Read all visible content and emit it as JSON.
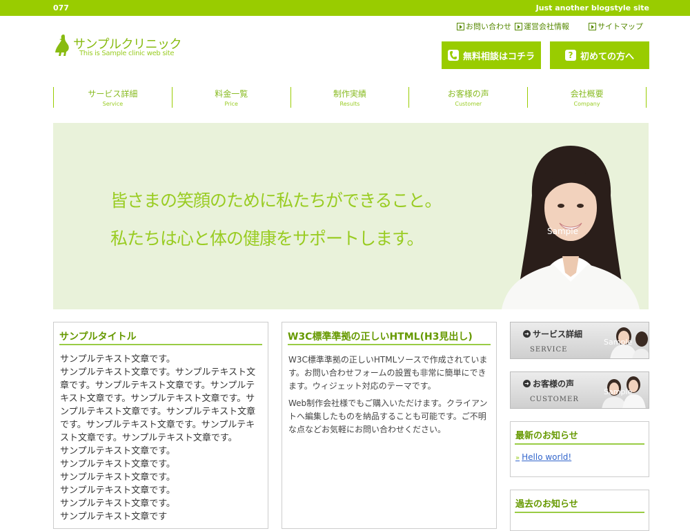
{
  "topbar": {
    "number": "077",
    "tagline": "Just another blogstyle site"
  },
  "logo": {
    "name": "サンプルクリニック",
    "subtitle": "This is Sample clinic web site"
  },
  "util_links": [
    {
      "label": "お問い合わせ"
    },
    {
      "label": "運営会社情報"
    },
    {
      "label": "サイトマップ"
    }
  ],
  "header_buttons": [
    {
      "label": "無料相談はコチラ",
      "icon": "phone-icon"
    },
    {
      "label": "初めての方へ",
      "icon": "question-icon",
      "glyph": "?"
    }
  ],
  "nav": [
    {
      "jp": "サービス詳細",
      "en": "Service"
    },
    {
      "jp": "料金一覧",
      "en": "Price"
    },
    {
      "jp": "制作実績",
      "en": "Results"
    },
    {
      "jp": "お客様の声",
      "en": "Customer"
    },
    {
      "jp": "会社概要",
      "en": "Company"
    }
  ],
  "hero": {
    "line1": "皆さまの笑顔のために私たちができること。",
    "line2": "私たちは心と体の健康をサポートします。",
    "watermark": "Sample"
  },
  "col1": {
    "title": "サンプルタイトル",
    "lines": [
      "サンプルテキスト文章です。",
      "サンプルテキスト文章です。サンプルテキスト文",
      "章です。サンプルテキスト文章です。サンプルテ",
      "キスト文章です。サンプルテキスト文章です。サ",
      "ンプルテキスト文章です。サンプルテキスト文章",
      "です。サンプルテキスト文章です。サンプルテキ",
      "スト文章です。サンプルテキスト文章です。",
      "サンプルテキスト文章です。",
      "サンプルテキスト文章です。",
      "サンプルテキスト文章です。",
      "サンプルテキスト文章です。",
      "サンプルテキスト文章です。",
      "サンプルテキスト文章です"
    ]
  },
  "col2": {
    "title": "W3C標準準拠の正しいHTML(H3見出し)",
    "p1": "W3C標準準拠の正しいHTMLソースで作成されています。お問い合わせフォームの設置も非常に簡単にできます。ウィジェット対応のテーマです。",
    "p2": "Web制作会社様でもご購入いただけます。クライアントへ編集したものを納品することも可能です。ご不明な点などお気軽にお問い合わせください。"
  },
  "banners": [
    {
      "title": "サービス詳細",
      "en": "SERVICE",
      "watermark": "Sample"
    },
    {
      "title": "お客様の声",
      "en": "CUSTOMER",
      "watermark": "Sample"
    }
  ],
  "news": {
    "title": "最新のお知らせ",
    "link": "Hello world!",
    "arrow": "»"
  },
  "past": {
    "title": "過去のお知らせ"
  },
  "colors": {
    "accent": "#99cc00",
    "heading": "#669900",
    "hero_bg": "#e9f2da"
  }
}
